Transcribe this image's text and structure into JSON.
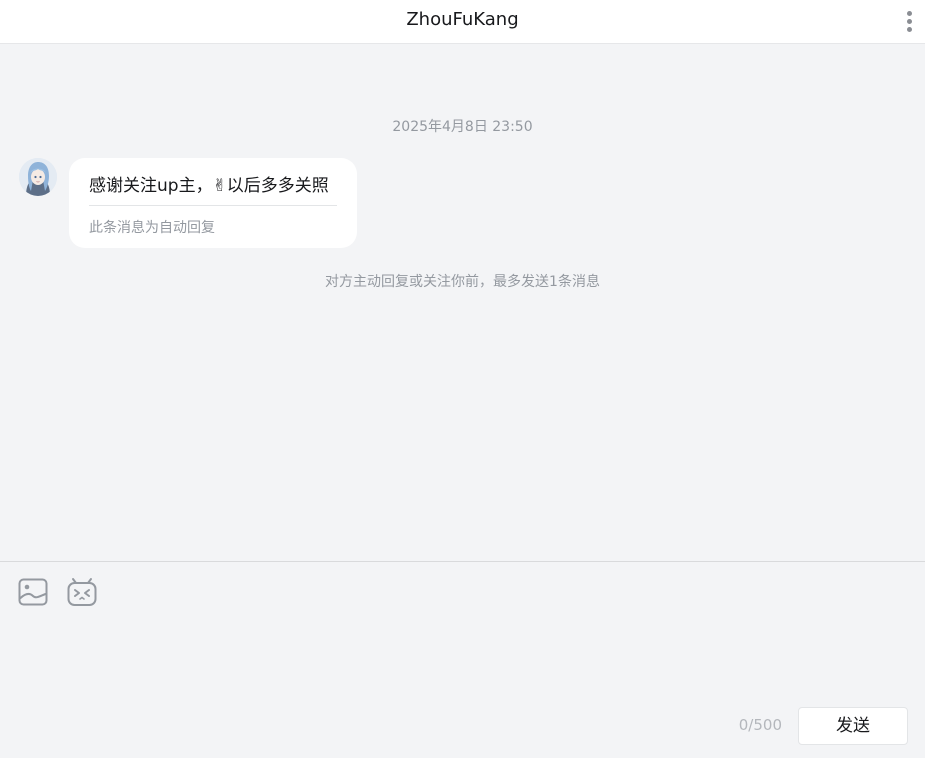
{
  "header": {
    "title": "ZhouFuKang",
    "more_icon": "vertical-ellipsis-icon"
  },
  "conversation": {
    "timestamp": "2025年4月8日 23:50",
    "message": {
      "text": "感谢关注up主，✌以后多多关照",
      "note": "此条消息为自动回复"
    },
    "system_note": "对方主动回复或关注你前，最多发送1条消息"
  },
  "composer": {
    "image_icon": "image-icon",
    "emoji_icon": "bilibili-tv-emoji-icon",
    "counter": "0/500",
    "send_label": "发送"
  },
  "colors": {
    "background": "#f3f4f6",
    "bubble": "#ffffff",
    "secondary_text": "#9499a0"
  }
}
